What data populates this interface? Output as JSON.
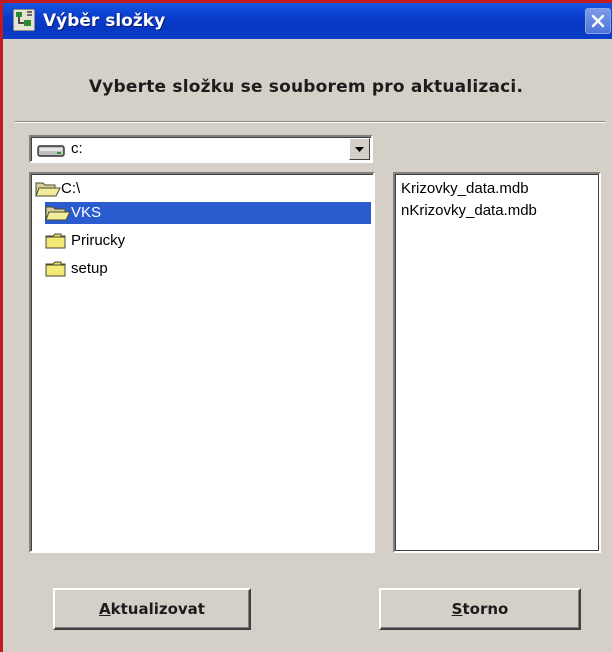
{
  "window": {
    "title": "Výběr složky"
  },
  "heading": "Vyberte složku se souborem pro aktualizaci.",
  "drive": {
    "selected": "c:",
    "icon": "hard-drive-icon"
  },
  "tree": {
    "items": [
      {
        "label": "C:\\",
        "icon": "open-folder-icon",
        "selected": false
      },
      {
        "label": "VKS",
        "icon": "open-folder-icon",
        "selected": true
      },
      {
        "label": "Prirucky",
        "icon": "closed-folder-icon",
        "selected": false
      },
      {
        "label": "setup",
        "icon": "closed-folder-icon",
        "selected": false
      }
    ]
  },
  "files": [
    "Krizovky_data.mdb",
    "nKrizovky_data.mdb"
  ],
  "buttons": {
    "update_mnemonic": "A",
    "update_rest": "ktualizovat",
    "cancel_mnemonic": "S",
    "cancel_rest": "torno"
  },
  "colors": {
    "title_bar": "#0a3dcc",
    "selection": "#2a5ccf",
    "face": "#d4d0c8",
    "frame_accent": "#c31a1e"
  }
}
